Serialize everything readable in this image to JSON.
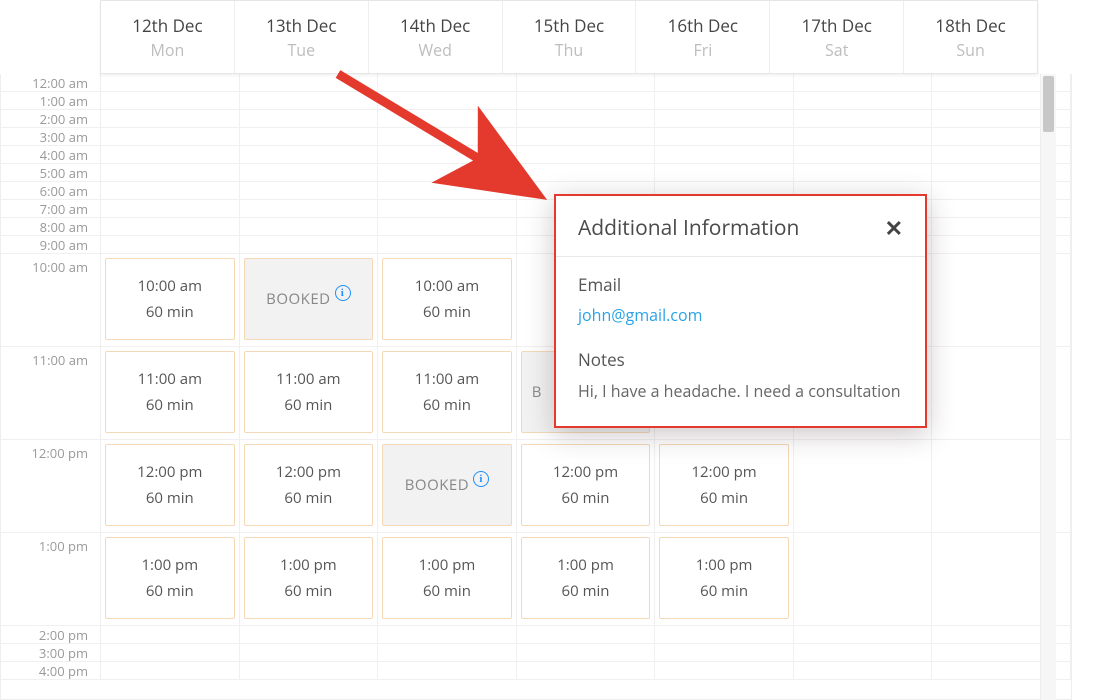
{
  "days": [
    {
      "date": "12th Dec",
      "dow": "Mon"
    },
    {
      "date": "13th Dec",
      "dow": "Tue"
    },
    {
      "date": "14th Dec",
      "dow": "Wed"
    },
    {
      "date": "15th Dec",
      "dow": "Thu"
    },
    {
      "date": "16th Dec",
      "dow": "Fri"
    },
    {
      "date": "17th Dec",
      "dow": "Sat"
    },
    {
      "date": "18th Dec",
      "dow": "Sun"
    }
  ],
  "time_labels": {
    "r1200a": "12:00 am",
    "r1a": "1:00 am",
    "r2a": "2:00 am",
    "r3a": "3:00 am",
    "r4a": "4:00 am",
    "r5a": "5:00 am",
    "r6a": "6:00 am",
    "r7a": "7:00 am",
    "r8a": "8:00 am",
    "r9a": "9:00 am",
    "r10a": "10:00 am",
    "r11a": "11:00 am",
    "r12p": "12:00 pm",
    "r1p": "1:00 pm",
    "r2p": "2:00 pm",
    "r3p": "3:00 pm",
    "r4p": "4:00 pm"
  },
  "labels": {
    "booked": "BOOKED",
    "duration": "60 min"
  },
  "slots": {
    "ten": "10:00 am",
    "eleven": "11:00 am",
    "twelve": "12:00 pm",
    "one": "1:00 pm"
  },
  "popover": {
    "title": "Additional Information",
    "email_label": "Email",
    "email_value": "john@gmail.com",
    "notes_label": "Notes",
    "notes_value": "Hi, I have a headache. I need a consultation"
  }
}
